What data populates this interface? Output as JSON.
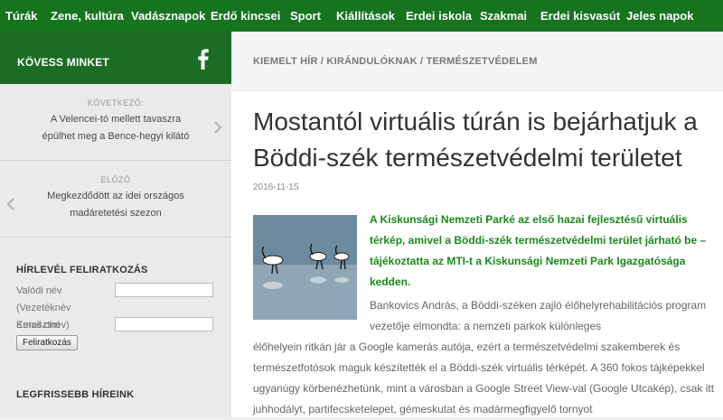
{
  "nav": {
    "items": [
      {
        "label": "Túrák"
      },
      {
        "label": "Zene, kultúra"
      },
      {
        "label": "Vadásznapok"
      },
      {
        "label": "Erdő kincsei"
      },
      {
        "label": "Sport"
      },
      {
        "label": "Kiállítások"
      },
      {
        "label": "Erdei iskola"
      },
      {
        "label": "Szakmai"
      },
      {
        "label": "Erdei kisvasút"
      },
      {
        "label": "Jeles napok"
      }
    ]
  },
  "sidebar": {
    "follow_title": "KÖVESS MINKET",
    "next": {
      "label": "KÖVETKEZŐ:",
      "link": "A Velencei-tó mellett tavaszra épülhet meg a Bence-hegyi kilátó"
    },
    "prev": {
      "label": "ELŐZŐ",
      "link": "Megkezdődött az idei országos madáretetési szezon"
    },
    "newsletter": {
      "title": "HÍRLEVÉL FELIRATKOZÁS",
      "name_label": "Valódi név (Vezetéknév Keresztnév)",
      "name_value": "",
      "email_label": "Email cím",
      "email_value": "",
      "submit_label": "Feliratkozás"
    },
    "hot_title": "LEGFRISSEBB HÍREINK"
  },
  "article": {
    "breadcrumb": "KIEMELT HÍR / KIRÁNDULÓKNAK / TERMÉSZETVÉDELEM",
    "title": "Mostantól virtuális túrán is bejárhatjuk a Böddi-szék természetvédelmi területet",
    "date": "2016-11-15",
    "lead": "A Kiskunsági Nemzeti Parké az első hazai fejlesztésű virtuális térkép, amivel a Böddi-szék természetvédelmi terület járható be – tájékoztatta az MTI-t a Kiskunsági Nemzeti Park Igazgatósága kedden.",
    "body_first": "Bankovics András, a Böddi-széken zajló élőhelyrehabilitációs program vezetője elmondta: a nemzeti parkok különleges",
    "body_rest": "élőhelyein ritkán jár a Google kamerás autója, ezért a természetvédelmi szakemberek és természetfotósok maguk készítették el a Böddi-szék virtuális térképét. A 360 fokos tájképekkel ugyanúgy körbenézhetünk, mint a városban a Google Street View-val (Google Utcakép), csak itt juhhodályt, partifecsketelepet, gémeskutat és madármegfigyelő tornyot"
  },
  "colors": {
    "nav_bg": "#16741f",
    "follow_bg": "#1b6d25",
    "lead_text": "#1a8a1a"
  },
  "icons": {
    "facebook": "facebook-icon",
    "next": "chevron-right-icon",
    "prev": "chevron-left-icon"
  }
}
